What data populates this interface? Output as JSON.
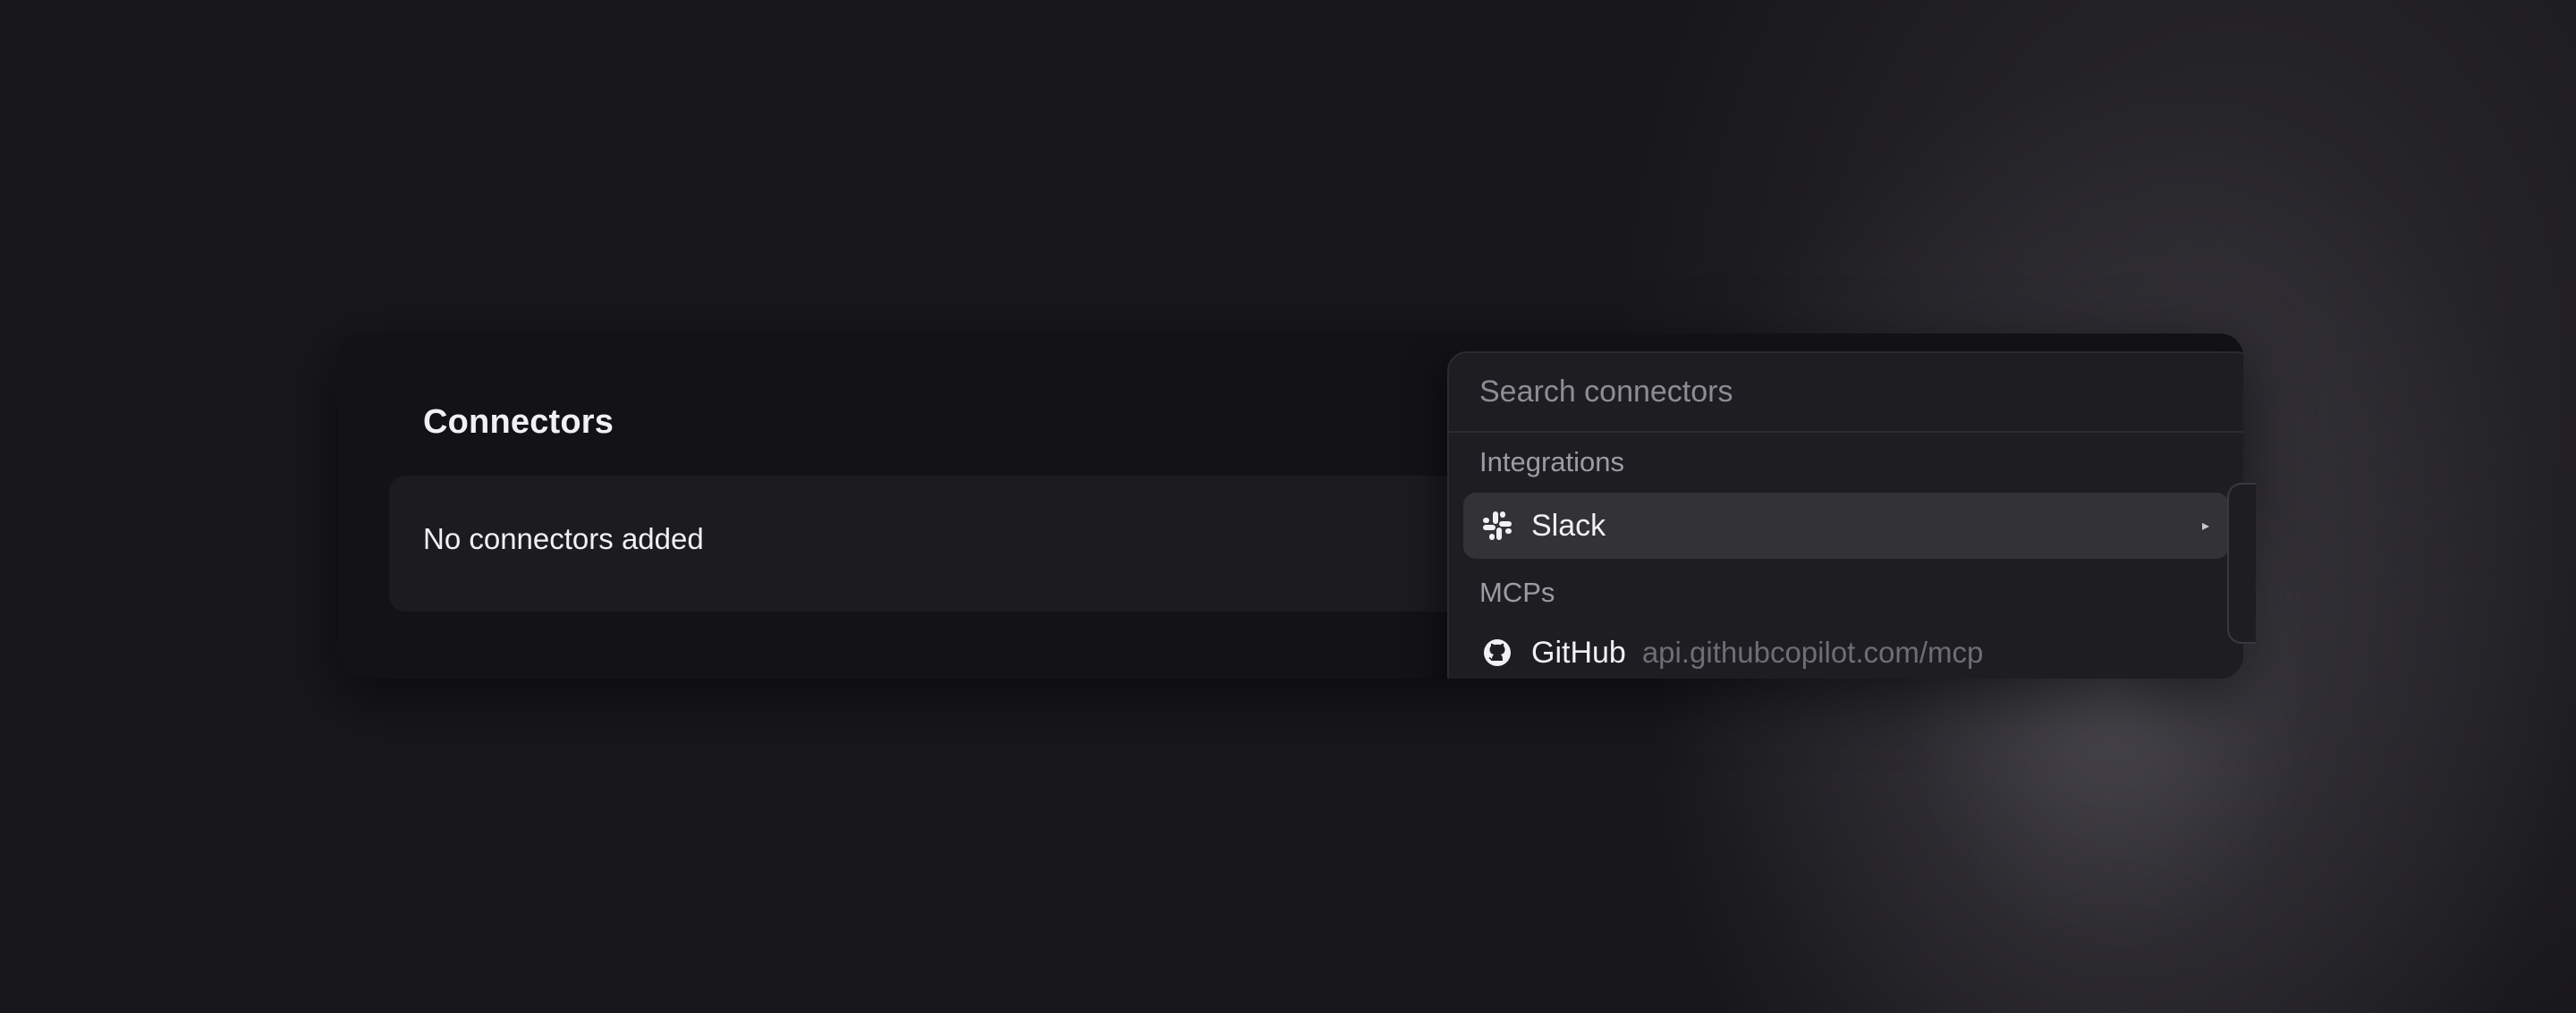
{
  "connectors": {
    "title": "Connectors",
    "empty_message": "No connectors added"
  },
  "dropdown": {
    "search_placeholder": "Search connectors",
    "sections": [
      {
        "label": "Integrations",
        "items": [
          {
            "name": "Slack",
            "icon": "slack-icon",
            "has_submenu": true,
            "highlighted": true
          }
        ]
      },
      {
        "label": "MCPs",
        "items": [
          {
            "name": "GitHub",
            "icon": "github-icon",
            "url": "api.githubcopilot.com/mcp"
          }
        ]
      }
    ]
  },
  "colors": {
    "background": "#18171b",
    "card": "#131216",
    "dropdown": "#1e1d22",
    "highlight": "#333237",
    "text_primary": "#f1f0f3",
    "text_muted": "#9d9ba3"
  }
}
